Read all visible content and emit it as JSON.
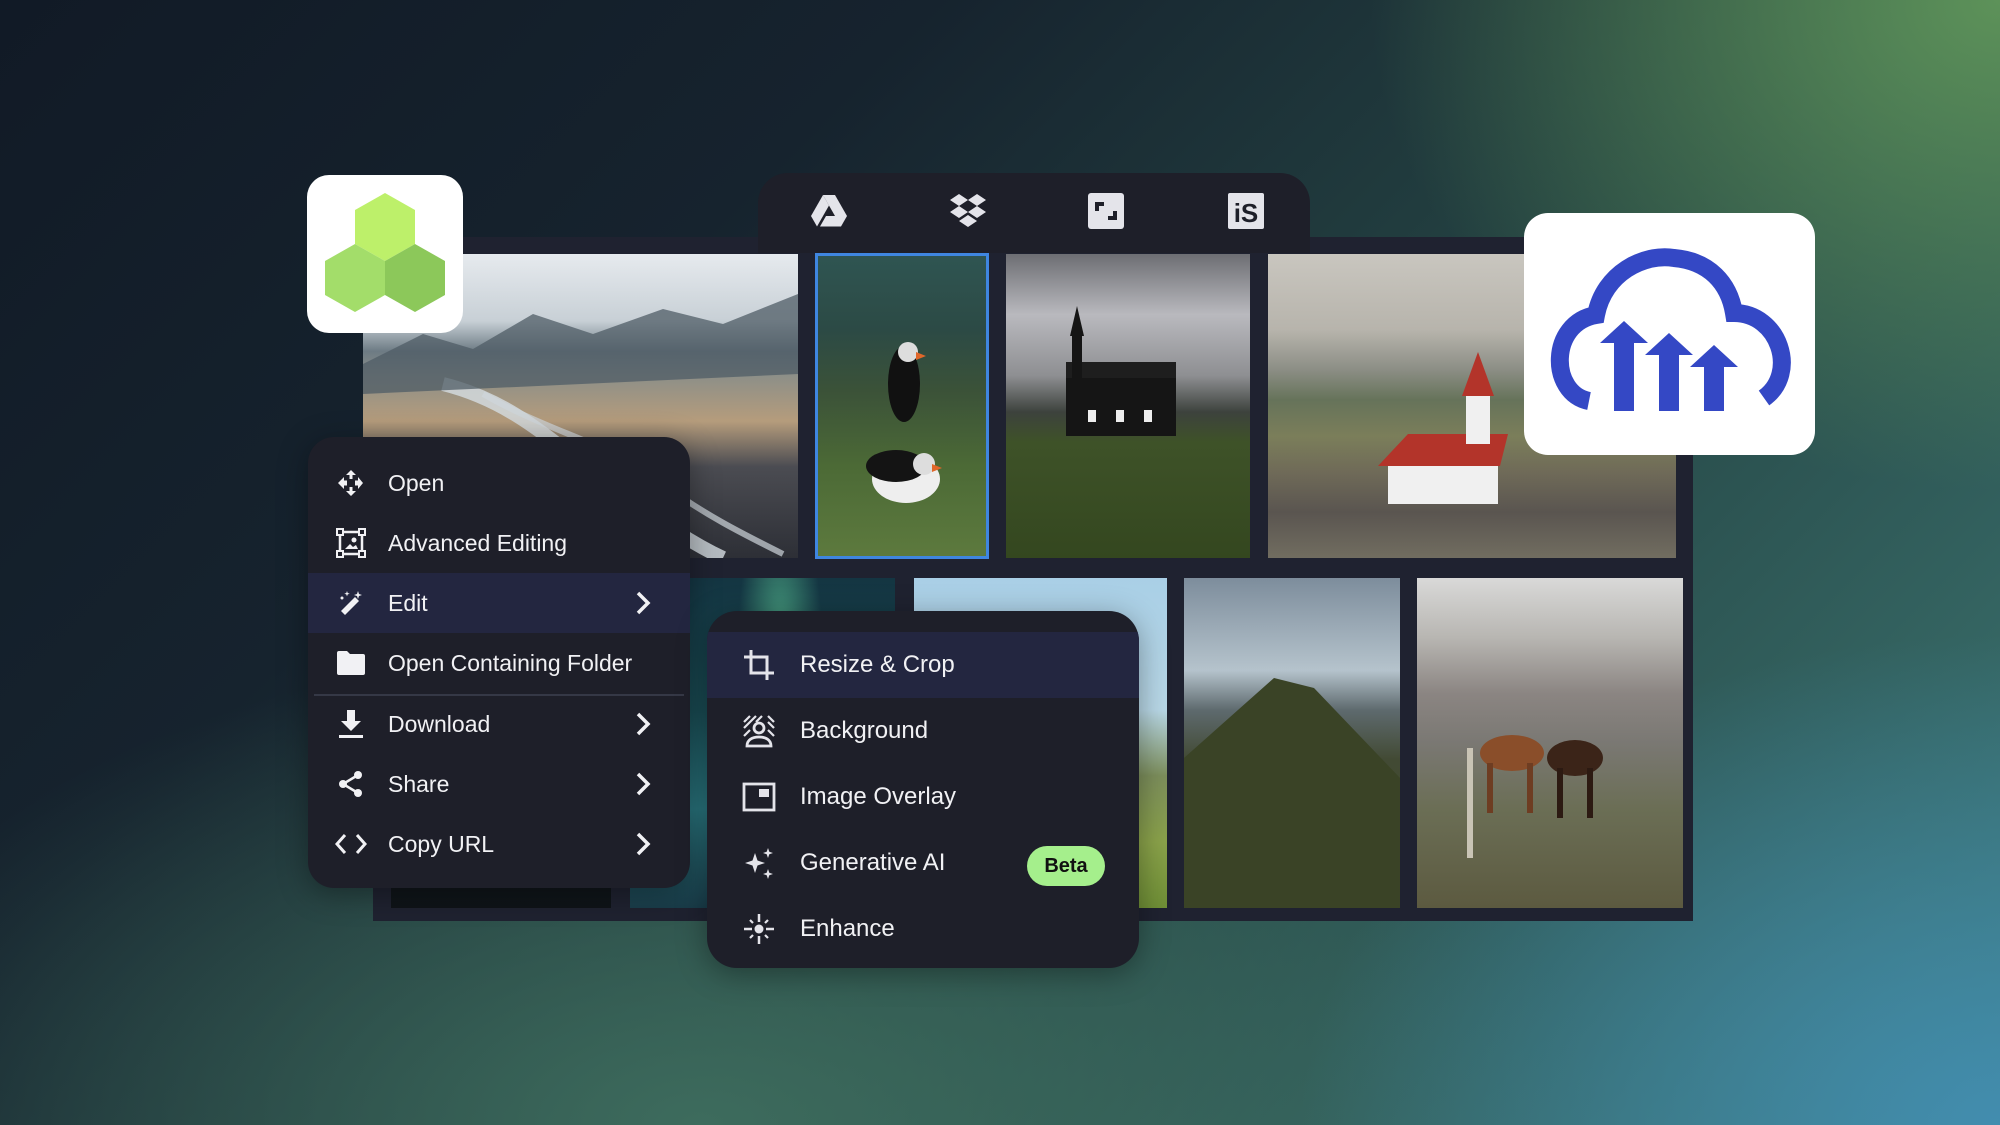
{
  "toolbar": {
    "sources": [
      {
        "name": "Google Drive",
        "icon": "google-drive-icon"
      },
      {
        "name": "Dropbox",
        "icon": "dropbox-icon"
      },
      {
        "name": "Shutterstock",
        "icon": "shutterstock-icon"
      },
      {
        "name": "iStock",
        "icon": "istock-icon",
        "glyph": "iS"
      }
    ]
  },
  "logos": {
    "left": {
      "icon": "hexagon-cluster-logo",
      "colors": [
        "#bdf06a",
        "#a3dd6a",
        "#8cc85a"
      ]
    },
    "right": {
      "icon": "cloudinary-cloud-logo",
      "color": "#3448c5"
    }
  },
  "context_menu": {
    "items": [
      {
        "label": "Open",
        "icon": "move-arrows-icon",
        "submenu": false
      },
      {
        "label": "Advanced Editing",
        "icon": "image-frame-icon",
        "submenu": false
      },
      {
        "label": "Edit",
        "icon": "magic-wand-icon",
        "submenu": true,
        "highlighted": true
      },
      {
        "label": "Open Containing Folder",
        "icon": "folder-icon",
        "submenu": false
      },
      {
        "label": "Download",
        "icon": "download-icon",
        "submenu": true
      },
      {
        "label": "Share",
        "icon": "share-icon",
        "submenu": true
      },
      {
        "label": "Copy URL",
        "icon": "code-brackets-icon",
        "submenu": true
      }
    ]
  },
  "edit_submenu": {
    "items": [
      {
        "label": "Resize & Crop",
        "icon": "crop-icon",
        "highlighted": true
      },
      {
        "label": "Background",
        "icon": "background-removal-icon"
      },
      {
        "label": "Image Overlay",
        "icon": "image-overlay-icon"
      },
      {
        "label": "Generative AI",
        "icon": "sparkles-icon",
        "badge": "Beta"
      },
      {
        "label": "Enhance",
        "icon": "enhance-icon"
      }
    ]
  },
  "colors": {
    "menu_bg": "#1e1f29",
    "menu_highlight": "#232640",
    "selection_border": "#3f86e0",
    "beta_badge": "#a5ef8c"
  }
}
